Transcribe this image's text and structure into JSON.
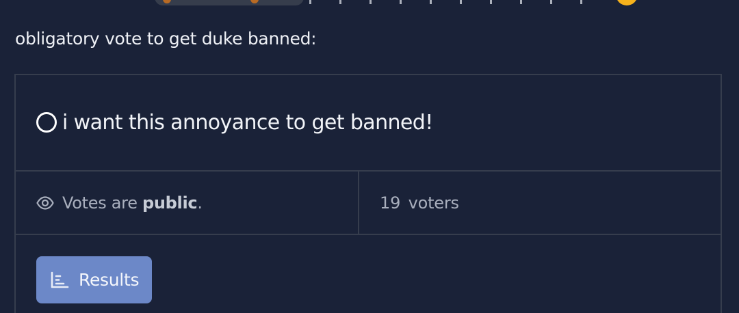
{
  "post": {
    "text": "obligatory vote to get duke banned:"
  },
  "poll": {
    "options": [
      {
        "label": "i want this annoyance to get banned!",
        "selected": false
      }
    ],
    "visibility": {
      "prefix": "Votes are ",
      "emphasis": "public",
      "suffix": "."
    },
    "voters": {
      "count": "19",
      "label": "voters"
    },
    "results_button": {
      "label": "Results"
    }
  },
  "colors": {
    "background": "#1a2238",
    "border": "#363d4d",
    "button": "#6c88c8",
    "muted_text": "#a9afbd"
  },
  "icons": {
    "radio": "radio-unchecked-icon",
    "visibility": "eye-icon",
    "results": "bar-chart-icon"
  }
}
